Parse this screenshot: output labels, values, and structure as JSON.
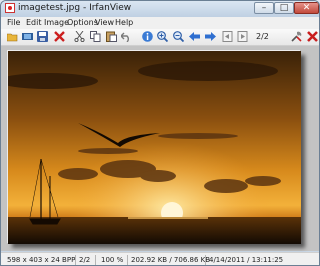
{
  "window": {
    "title": "imagetest.jpg - IrfanView",
    "min_label": "–",
    "max_label": "□",
    "close_label": "✕"
  },
  "menu": {
    "items": [
      "File",
      "Edit",
      "Image",
      "Options",
      "View",
      "Help"
    ]
  },
  "toolbar": {
    "icons": [
      "open-folder-icon",
      "filmstrip-icon",
      "save-icon",
      "delete-icon",
      "cut-icon",
      "copy-icon",
      "paste-icon",
      "undo-icon",
      "info-icon",
      "zoom-in-icon",
      "zoom-out-icon",
      "previous-arrow-icon",
      "next-arrow-icon",
      "first-page-icon",
      "last-page-icon",
      "settings-icon",
      "exit-icon"
    ],
    "page_counter": "2/2"
  },
  "status": {
    "dimensions": "598 x 403 x 24 BPP",
    "page": "2/2",
    "zoom": "100 %",
    "size": "202.92 KB / 706.86 KB",
    "date": "4/14/2011 / 13:11:25"
  },
  "colors": {
    "accent": "#3a7bd5",
    "sky_top": "#3a2208",
    "sky_mid": "#d78a1c",
    "sea": "#1c1006"
  }
}
